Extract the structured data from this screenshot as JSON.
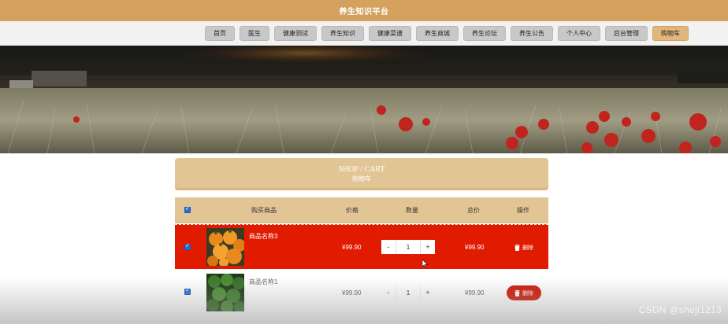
{
  "header": {
    "title": "养生知识平台"
  },
  "nav": {
    "items": [
      {
        "label": "首页",
        "active": false
      },
      {
        "label": "医生",
        "active": false
      },
      {
        "label": "健康测试",
        "active": false
      },
      {
        "label": "养生知识",
        "active": false
      },
      {
        "label": "健康菜谱",
        "active": false
      },
      {
        "label": "养生商城",
        "active": false
      },
      {
        "label": "养生论坛",
        "active": false
      },
      {
        "label": "养生公告",
        "active": false
      },
      {
        "label": "个人中心",
        "active": false
      },
      {
        "label": "后台管理",
        "active": false
      },
      {
        "label": "购物车",
        "active": true
      }
    ]
  },
  "cart": {
    "title_en": "SHOP / CART",
    "title_cn": "购物车",
    "columns": {
      "product": "购买商品",
      "price": "价格",
      "qty": "数量",
      "total": "总价",
      "action": "操作"
    },
    "rows": [
      {
        "name": "商品名称3",
        "price": "¥99.90",
        "qty": "1",
        "total": "¥99.90",
        "delete_label": "删除",
        "checked": true,
        "image": "orange-fruit"
      },
      {
        "name": "商品名称1",
        "price": "¥99.90",
        "qty": "1",
        "total": "¥99.90",
        "delete_label": "删除",
        "checked": true,
        "image": "broccoli"
      }
    ],
    "minus": "-",
    "plus": "+"
  },
  "watermark": "CSDN @sheji1213",
  "colors": {
    "brand": "#d4a15e",
    "highlight_row": "#e01b00",
    "delete_button": "#cf1a0a",
    "header_band": "#e2c594"
  }
}
